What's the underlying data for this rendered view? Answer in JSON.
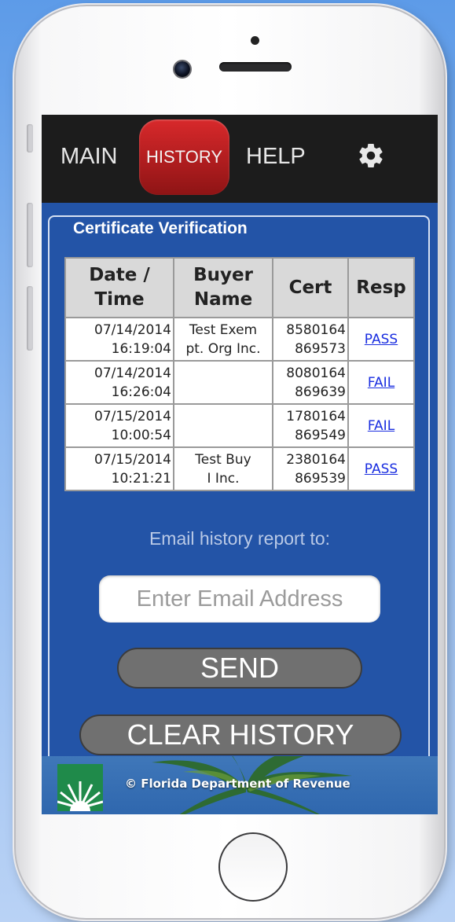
{
  "nav": {
    "main_label": "MAIN",
    "history_label": "HISTORY",
    "help_label": "HELP",
    "settings_icon": "gear-icon"
  },
  "section": {
    "legend": "Certificate Verification"
  },
  "table": {
    "headers": {
      "date_line1": "Date /",
      "date_line2": "Time",
      "buyer_line1": "Buyer",
      "buyer_line2": "Name",
      "cert": "Cert",
      "resp": "Resp"
    },
    "rows": [
      {
        "date": "07/14/2014",
        "time": "16:19:04",
        "buyer_line1": "Test Exem",
        "buyer_line2": "pt. Org Inc.",
        "cert_line1": "8580164",
        "cert_line2": "869573",
        "resp": "PASS"
      },
      {
        "date": "07/14/2014",
        "time": "16:26:04",
        "buyer_line1": "",
        "buyer_line2": "",
        "cert_line1": "8080164",
        "cert_line2": "869639",
        "resp": "FAIL"
      },
      {
        "date": "07/15/2014",
        "time": "10:00:54",
        "buyer_line1": "",
        "buyer_line2": "",
        "cert_line1": "1780164",
        "cert_line2": "869549",
        "resp": "FAIL"
      },
      {
        "date": "07/15/2014",
        "time": "10:21:21",
        "buyer_line1": "Test Buy",
        "buyer_line2": "I Inc.",
        "cert_line1": "2380164",
        "cert_line2": "869539",
        "resp": "PASS"
      }
    ]
  },
  "email": {
    "label": "Email history report to:",
    "placeholder": "Enter Email Address",
    "value": ""
  },
  "buttons": {
    "send_label": "SEND",
    "clear_label": "CLEAR HISTORY"
  },
  "footer": {
    "copyright": "© Florida Department of Revenue"
  },
  "colors": {
    "content_bg": "#2354a7",
    "active_tab": "#c4282a",
    "link": "#1a2ee0"
  }
}
